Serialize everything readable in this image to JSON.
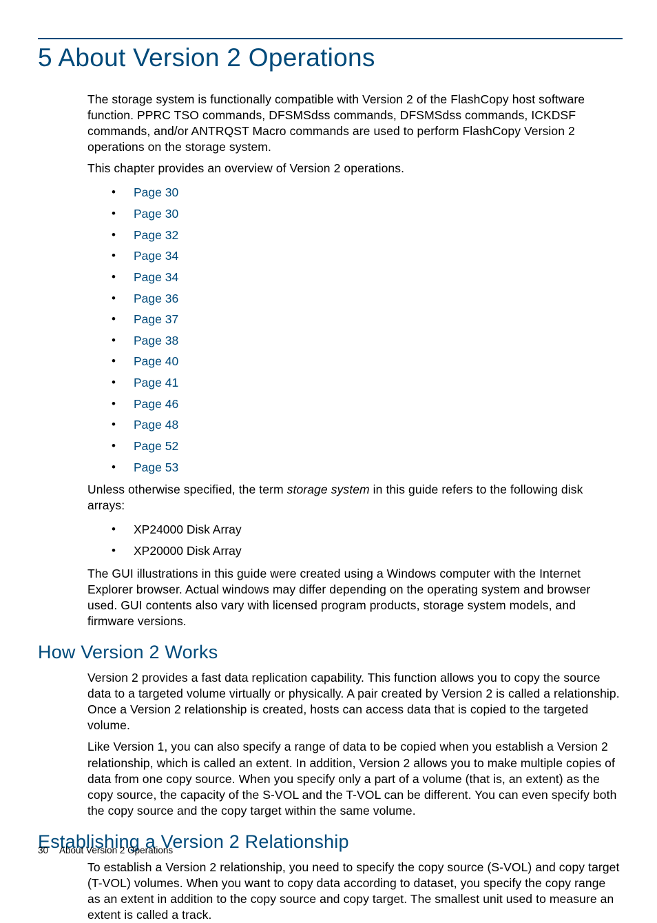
{
  "heading1": "5 About Version 2 Operations",
  "intro_p1": "The storage system is functionally compatible with Version 2 of the FlashCopy host software function. PPRC TSO commands, DFSMSdss commands, DFSMSdss commands, ICKDSF commands, and/or ANTRQST Macro commands are used to perform FlashCopy Version 2 operations on the storage system.",
  "intro_p2": "This chapter provides an overview of Version 2 operations.",
  "page_links": [
    "Page 30",
    "Page 30",
    "Page 32",
    "Page 34",
    "Page 34",
    "Page 36",
    "Page 37",
    "Page 38",
    "Page 40",
    "Page 41",
    "Page 46",
    "Page 48",
    "Page 52",
    "Page 53"
  ],
  "p_unless_pre": "Unless otherwise specified, the term ",
  "p_unless_em": "storage system",
  "p_unless_post": " in this guide refers to the following disk arrays:",
  "disk_arrays": [
    "XP24000 Disk Array",
    "XP20000 Disk Array"
  ],
  "p_gui": "The GUI illustrations in this guide were created using a Windows computer with the Internet Explorer browser. Actual windows may differ depending on the operating system and browser used. GUI contents also vary with licensed program products, storage system models, and firmware versions.",
  "heading2a": "How Version 2 Works",
  "h2a_p1": "Version 2 provides a fast data replication capability. This function allows you to copy the source data to a targeted volume virtually or physically. A pair created by Version 2 is called a relationship. Once a Version 2 relationship is created, hosts can access data that is copied to the targeted volume.",
  "h2a_p2": "Like Version 1, you can also specify a range of data to be copied when you establish a Version 2 relationship, which is called an extent. In addition, Version 2 allows you to make multiple copies of data from one copy source. When you specify only a part of a volume (that is, an extent) as the copy source, the capacity of the S-VOL and the T-VOL can be different. You can even specify both the copy source and the copy target within the same volume.",
  "heading2b": "Establishing a Version 2 Relationship",
  "h2b_p1": "To establish a Version 2 relationship, you need to specify the copy source (S-VOL) and copy target (T-VOL) volumes. When you want to copy data according to dataset, you specify the copy range as an extent in addition to the copy source and copy target. The smallest unit used to measure an extent is called a track.",
  "footer_page": "30",
  "footer_text": "About Version 2 Operations"
}
